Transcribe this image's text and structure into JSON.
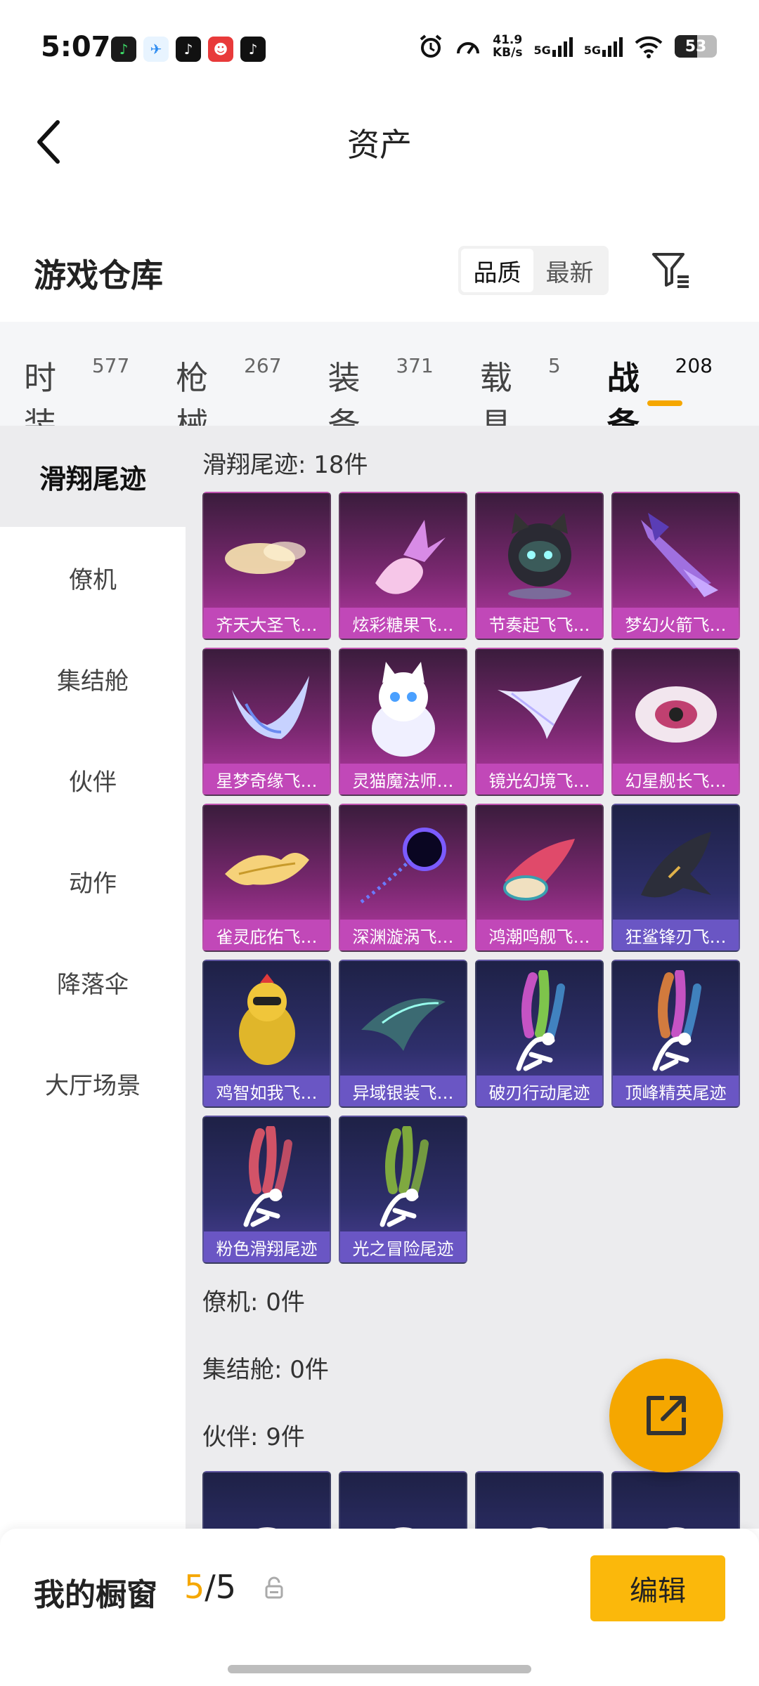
{
  "status_bar": {
    "time": "5:07",
    "app_icons": [
      "music-app-icon",
      "flight-app-icon",
      "tiktok-icon",
      "game-app-icon",
      "tiktok-icon"
    ],
    "net_speed_value": "41.9",
    "net_speed_unit": "KB/s",
    "signal_1": "5G",
    "signal_2": "5G",
    "battery": "53"
  },
  "header": {
    "title": "资产"
  },
  "warehouse": {
    "title": "游戏仓库",
    "sort_options": [
      "品质",
      "最新"
    ],
    "active_sort": "品质"
  },
  "tabs": [
    {
      "label": "时装",
      "count": "577"
    },
    {
      "label": "枪械",
      "count": "267"
    },
    {
      "label": "装备",
      "count": "371"
    },
    {
      "label": "载具",
      "count": "5"
    },
    {
      "label": "战备",
      "count": "208"
    }
  ],
  "active_tab": "战备",
  "sidebar": [
    "滑翔尾迹",
    "僚机",
    "集结舱",
    "伙伴",
    "动作",
    "降落伞",
    "大厅场景"
  ],
  "active_sidebar": "滑翔尾迹",
  "groups": {
    "glide": {
      "title": "滑翔尾迹: 18件",
      "items": [
        {
          "name": "齐天大圣飞…",
          "tier": "purple",
          "icon": "cloud-icon"
        },
        {
          "name": "炫彩糖果飞…",
          "tier": "purple",
          "icon": "candy-icon"
        },
        {
          "name": "节奏起飞飞…",
          "tier": "purple",
          "icon": "robot-cat-icon"
        },
        {
          "name": "梦幻火箭飞…",
          "tier": "purple",
          "icon": "rocket-icon"
        },
        {
          "name": "星梦奇缘飞…",
          "tier": "purple",
          "icon": "wing-icon"
        },
        {
          "name": "灵猫魔法师…",
          "tier": "purple",
          "icon": "cat-icon"
        },
        {
          "name": "镜光幻境飞…",
          "tier": "purple",
          "icon": "feather-wing-icon"
        },
        {
          "name": "幻星舰长飞…",
          "tier": "purple",
          "icon": "saucer-icon"
        },
        {
          "name": "雀灵庇佑飞…",
          "tier": "purple",
          "icon": "golden-feather-icon"
        },
        {
          "name": "深渊漩涡飞…",
          "tier": "purple",
          "icon": "vortex-icon"
        },
        {
          "name": "鸿潮鸣舰飞…",
          "tier": "purple",
          "icon": "ship-icon"
        },
        {
          "name": "狂鲨锋刃飞…",
          "tier": "blue",
          "icon": "shark-icon"
        },
        {
          "name": "鸡智如我飞…",
          "tier": "blue",
          "icon": "chicken-icon"
        },
        {
          "name": "异域银装飞…",
          "tier": "blue",
          "icon": "blade-wing-icon"
        },
        {
          "name": "破刃行动尾迹",
          "tier": "blue",
          "icon": "smoke-trail-icon",
          "colors": [
            "#e05bd6",
            "#8ee04a",
            "#4aa0e0"
          ]
        },
        {
          "name": "顶峰精英尾迹",
          "tier": "blue",
          "icon": "smoke-trail-icon",
          "colors": [
            "#f08a3a",
            "#e05bd6",
            "#4aa0e0"
          ]
        },
        {
          "name": "粉色滑翔尾迹",
          "tier": "blue",
          "icon": "smoke-trail-icon",
          "colors": [
            "#f05a6a",
            "#f05a6a",
            "#f05a6a"
          ]
        },
        {
          "name": "光之冒险尾迹",
          "tier": "blue",
          "icon": "smoke-trail-icon",
          "colors": [
            "#8ec03a",
            "#8ec03a",
            "#8ec03a"
          ]
        }
      ]
    },
    "wingman": {
      "title": "僚机: 0件"
    },
    "pod": {
      "title": "集结舱: 0件"
    },
    "partner": {
      "title": "伙伴: 9件",
      "items": [
        {
          "icon": "companion-icon"
        },
        {
          "icon": "companion-icon"
        },
        {
          "icon": "companion-icon"
        },
        {
          "icon": "companion-icon"
        }
      ]
    }
  },
  "bottom_bar": {
    "label": "我的橱窗",
    "current": "5",
    "separator": "/",
    "total": "5",
    "edit_label": "编辑"
  },
  "colors": {
    "accent": "#f5a700",
    "purple_tier": "#c148b8",
    "blue_tier": "#6a56c4"
  }
}
